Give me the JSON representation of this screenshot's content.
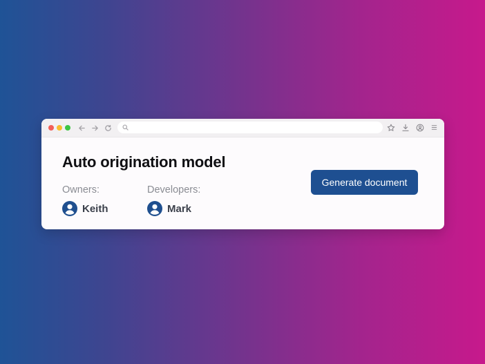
{
  "colors": {
    "accent": "#1e4f91",
    "gradient_left": "#1f5396",
    "gradient_right": "#c7198c"
  },
  "browser": {
    "nav_icons": [
      "back-arrow-icon",
      "forward-arrow-icon",
      "reload-icon"
    ],
    "address_placeholder": "",
    "tool_icons": [
      "star-icon",
      "download-icon",
      "account-icon",
      "menu-icon"
    ]
  },
  "page": {
    "title": "Auto origination model",
    "owners": {
      "label": "Owners:",
      "people": [
        {
          "name": "Keith",
          "icon": "user-avatar-icon"
        }
      ]
    },
    "developers": {
      "label": "Developers:",
      "people": [
        {
          "name": "Mark",
          "icon": "user-avatar-icon"
        }
      ]
    },
    "generate_button_label": "Generate document"
  }
}
